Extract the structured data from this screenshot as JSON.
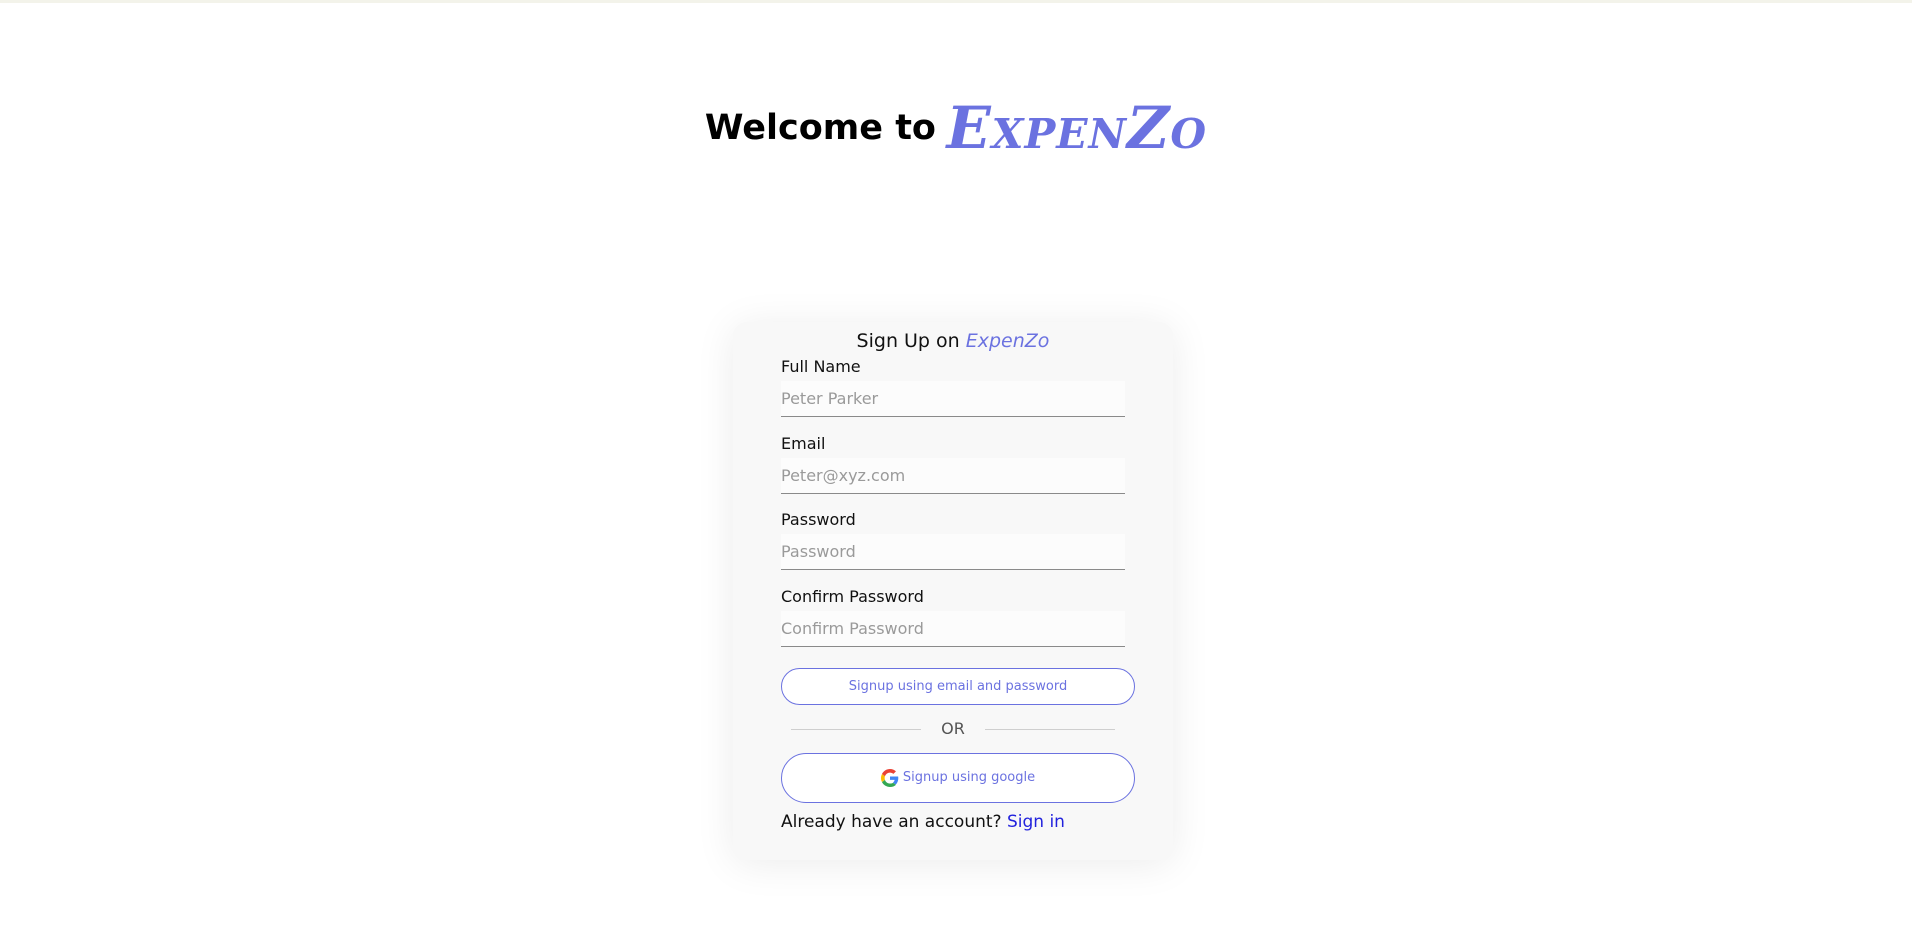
{
  "header": {
    "welcome_text": "Welcome to",
    "brand": "ExpenZo"
  },
  "form": {
    "title_prefix": "Sign Up on",
    "title_brand": "ExpenZo",
    "fields": [
      {
        "label": "Full Name",
        "placeholder": "Peter Parker",
        "value": ""
      },
      {
        "label": "Email",
        "placeholder": "Peter@xyz.com",
        "value": ""
      },
      {
        "label": "Password",
        "placeholder": "Password",
        "value": ""
      },
      {
        "label": "Confirm Password",
        "placeholder": "Confirm Password",
        "value": ""
      }
    ],
    "email_button_label": "Signup using email and password",
    "divider_text": "OR",
    "google_button_label": "Signup using google",
    "signin_prompt": "Already have an account?",
    "signin_link": "Sign in"
  },
  "colors": {
    "brand": "#6b72e0",
    "link": "#2222dd",
    "card_background": "#f8f8f8"
  },
  "icons": {
    "google_button_icon": "google-icon"
  }
}
